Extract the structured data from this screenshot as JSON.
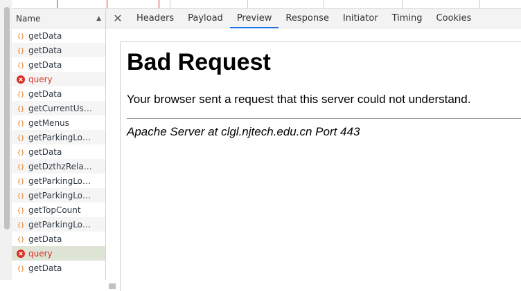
{
  "request_list": {
    "header": "Name",
    "rows": [
      {
        "name": "getData",
        "status": "ok"
      },
      {
        "name": "getData",
        "status": "ok"
      },
      {
        "name": "getData",
        "status": "ok"
      },
      {
        "name": "query",
        "status": "error"
      },
      {
        "name": "getData",
        "status": "ok"
      },
      {
        "name": "getCurrentUser",
        "status": "ok"
      },
      {
        "name": "getMenus",
        "status": "ok"
      },
      {
        "name": "getParkingLot...",
        "status": "ok"
      },
      {
        "name": "getData",
        "status": "ok"
      },
      {
        "name": "getDzthzRelat...",
        "status": "ok"
      },
      {
        "name": "getParkingLot...",
        "status": "ok"
      },
      {
        "name": "getParkingLot...",
        "status": "ok"
      },
      {
        "name": "getTopCount",
        "status": "ok"
      },
      {
        "name": "getParkingLot...",
        "status": "ok"
      },
      {
        "name": "getData",
        "status": "ok"
      },
      {
        "name": "query",
        "status": "error"
      },
      {
        "name": "getData",
        "status": "ok"
      }
    ]
  },
  "details": {
    "tabs": [
      "Headers",
      "Payload",
      "Preview",
      "Response",
      "Initiator",
      "Timing",
      "Cookies"
    ],
    "active_tab": "Preview"
  },
  "preview": {
    "heading": "Bad Request",
    "message": "Your browser sent a request that this server could not understand.",
    "address": "Apache Server at clgl.njtech.edu.cn Port 443"
  },
  "colors": {
    "error": "#d93025",
    "xhr_icon": "#e8710a",
    "active_tab_underline": "#1a73e8",
    "selected_row": "#dfe5d6"
  }
}
